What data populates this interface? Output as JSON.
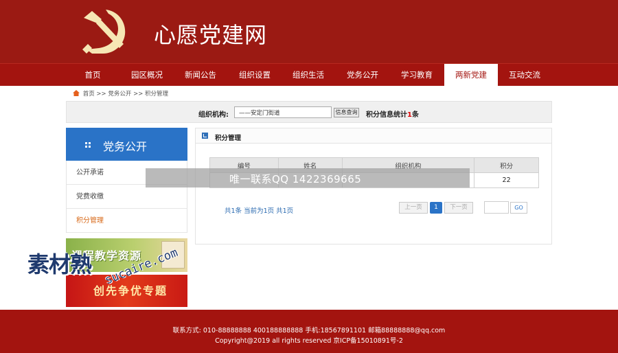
{
  "header": {
    "site_title": "心愿党建网",
    "brand_color": "#9b1a13",
    "logo_icon": "hammer-sickle-icon"
  },
  "nav": {
    "items": [
      {
        "label": "首页"
      },
      {
        "label": "园区概况"
      },
      {
        "label": "新闻公告"
      },
      {
        "label": "组织设置"
      },
      {
        "label": "组织生活"
      },
      {
        "label": "党务公开"
      },
      {
        "label": "学习教育"
      },
      {
        "label": "两新党建"
      },
      {
        "label": "互动交流"
      }
    ],
    "active": "两新党建"
  },
  "breadcrumb": {
    "home": "首页",
    "sep1": ">>",
    "section": "党务公开",
    "sep2": ">>",
    "current": "积分管理"
  },
  "search": {
    "label": "组织机构:",
    "value": "——安定门街道",
    "button": "信息查询",
    "stats_prefix": "积分信息统计",
    "stats_count": "1",
    "stats_suffix": "条"
  },
  "sidebar": {
    "title": "党务公开",
    "accent_color": "#2a73c7",
    "items": [
      {
        "label": "公开承诺"
      },
      {
        "label": "党费收缴"
      },
      {
        "label": "积分管理"
      }
    ],
    "banners": [
      {
        "label": "课程教学资源"
      },
      {
        "label": "创先争优专题"
      }
    ]
  },
  "content": {
    "title": "积分管理",
    "table": {
      "headers": [
        "编号",
        "姓名",
        "组织机构",
        "积分"
      ],
      "rows": [
        [
          "",
          "",
          "",
          "22"
        ]
      ]
    },
    "pager": {
      "info": "共1条 当前为1页 共1页",
      "prev": "上一页",
      "current": "1",
      "next": "下一页",
      "go": "GO"
    }
  },
  "watermark": {
    "bar_text": "唯一联系QQ 1422369665",
    "logo_text": "素材熟",
    "url_text": "sucaire.com"
  },
  "footer": {
    "line1": "联系方式: 010-88888888 400188888888 手机:18567891101 邮箱88888888@qq.com",
    "line2": "Copyright@2019 all rights reserved 京ICP备15010891号-2"
  }
}
